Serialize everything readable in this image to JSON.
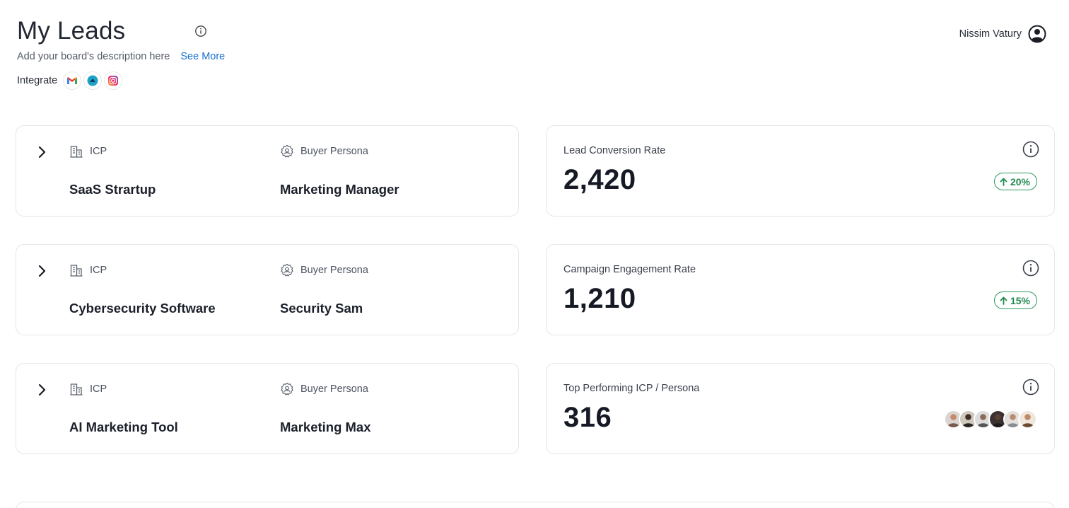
{
  "header": {
    "title": "My Leads",
    "description": "Add your board's description here",
    "see_more": "See More",
    "integrate_label": "Integrate",
    "integrations": [
      "gmail-icon",
      "integration-app-icon",
      "instagram-icon"
    ]
  },
  "user": {
    "name": "Nissim Vatury"
  },
  "leads": [
    {
      "icp_label": "ICP",
      "persona_label": "Buyer Persona",
      "icp": "SaaS Strartup",
      "persona": "Marketing Manager"
    },
    {
      "icp_label": "ICP",
      "persona_label": "Buyer Persona",
      "icp": "Cybersecurity Software",
      "persona": "Security Sam"
    },
    {
      "icp_label": "ICP",
      "persona_label": "Buyer Persona",
      "icp": "AI Marketing Tool",
      "persona": "Marketing Max"
    }
  ],
  "metrics": [
    {
      "label": "Lead Conversion Rate",
      "value": "2,420",
      "change": "20%"
    },
    {
      "label": "Campaign Engagement Rate",
      "value": "1,210",
      "change": "15%"
    },
    {
      "label": "Top Performing ICP / Persona",
      "value": "316"
    }
  ],
  "colors": {
    "accent_link": "#1a6fd1",
    "positive": "#1f8a4f",
    "border": "#e4e6ea"
  }
}
